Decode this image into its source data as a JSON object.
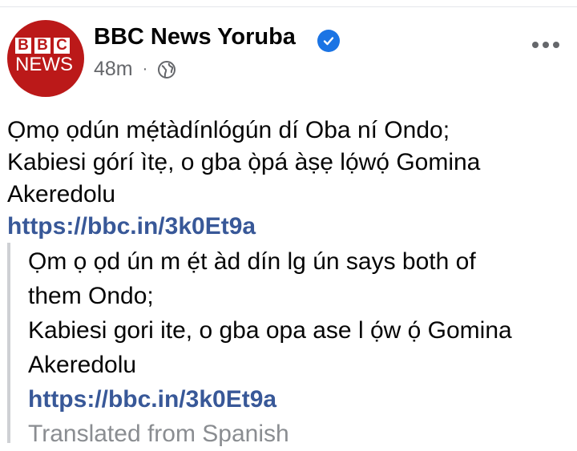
{
  "header": {
    "page_name": "BBC News Yoruba",
    "time_ago": "48m",
    "separator": "·"
  },
  "avatar": {
    "bbc_letters": [
      "B",
      "B",
      "C"
    ],
    "news_label": "NEWS"
  },
  "post": {
    "line1": "Ọmọ ọdún mẹ́tàdínlógún dí Oba ní Ondo;",
    "line2": "Kabiesi górí ìtẹ, o gba ọ̀pá àṣẹ lọ́wọ́ Gomina",
    "line3": "Akeredolu",
    "link": "https://bbc.in/3k0Et9a"
  },
  "translation": {
    "line1": "Ọm ọ ọd ún m ẹ́t àd dín lg ún says both of",
    "line2": "them Ondo;",
    "line3": "Kabiesi gori ite, o gba opa ase l ọ́w ọ́ Gomina",
    "line4": "Akeredolu",
    "link": "https://bbc.in/3k0Et9a",
    "note": "Translated from Spanish"
  },
  "colors": {
    "bbc_red": "#bb1919",
    "verified_blue": "#1b74e4",
    "link": "#385898",
    "muted": "#65676b"
  }
}
